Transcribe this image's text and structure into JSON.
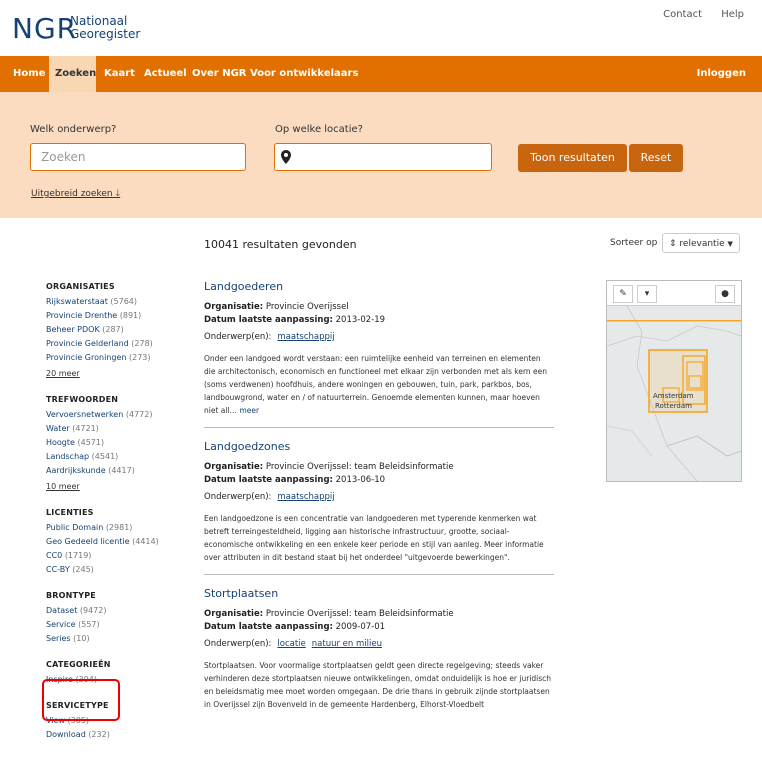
{
  "header": {
    "logo_ngr": "NGR",
    "logo_line1": "Nationaal",
    "logo_line2": "Georegister",
    "links": [
      "Contact",
      "Help"
    ]
  },
  "nav": {
    "items": [
      "Home",
      "Zoeken",
      "Kaart",
      "Actueel",
      "Over NGR",
      "Voor ontwikkelaars"
    ],
    "active": "Zoeken",
    "login": "Inloggen"
  },
  "search": {
    "topic_label": "Welk onderwerp?",
    "topic_placeholder": "Zoeken",
    "location_label": "Op welke locatie?",
    "location_placeholder": "",
    "submit_label": "Toon resultaten",
    "reset_label": "Reset",
    "advanced_label": "Uitgebreid zoeken"
  },
  "results_count": "10041 resultaten gevonden",
  "sort": {
    "label": "Sorteer op",
    "selected": "relevantie"
  },
  "facets": [
    {
      "title": "ORGANISATIES",
      "items": [
        {
          "label": "Rijkswaterstaat",
          "count": "(5764)"
        },
        {
          "label": "Provincie Drenthe",
          "count": "(891)"
        },
        {
          "label": "Beheer PDOK",
          "count": "(287)"
        },
        {
          "label": "Provincie Gelderland",
          "count": "(278)"
        },
        {
          "label": "Provincie Groningen",
          "count": "(273)"
        }
      ],
      "more": "20 meer"
    },
    {
      "title": "TREFWOORDEN",
      "items": [
        {
          "label": "Vervoersnetwerken",
          "count": "(4772)"
        },
        {
          "label": "Water",
          "count": "(4721)"
        },
        {
          "label": "Hoogte",
          "count": "(4571)"
        },
        {
          "label": "Landschap",
          "count": "(4541)"
        },
        {
          "label": "Aardrijkskunde",
          "count": "(4417)"
        }
      ],
      "more": "10 meer"
    },
    {
      "title": "LICENTIES",
      "items": [
        {
          "label": "Public Domain",
          "count": "(2981)"
        },
        {
          "label": "Geo Gedeeld licentie",
          "count": "(4414)"
        },
        {
          "label": "CC0",
          "count": "(1719)"
        },
        {
          "label": "CC-BY",
          "count": "(245)"
        }
      ],
      "more": ""
    },
    {
      "title": "BRONTYPE",
      "items": [
        {
          "label": "Dataset",
          "count": "(9472)"
        },
        {
          "label": "Service",
          "count": "(557)"
        },
        {
          "label": "Series",
          "count": "(10)"
        }
      ],
      "more": ""
    },
    {
      "title": "CATEGORIEËN",
      "items": [
        {
          "label": "Inspire",
          "count": "(394)"
        }
      ],
      "more": ""
    },
    {
      "title": "SERVICETYPE",
      "items": [
        {
          "label": "View",
          "count": "(305)"
        },
        {
          "label": "Download",
          "count": "(232)"
        }
      ],
      "more": ""
    }
  ],
  "labels": {
    "org": "Organisatie:",
    "date": "Datum laatste aanpassing:",
    "subject": "Onderwerp(en):"
  },
  "results": [
    {
      "title": "Landgoederen",
      "organisation": "Provincie Overijssel",
      "date": "2013-02-19",
      "subjects": [
        "maatschappij"
      ],
      "description": "Onder een landgoed wordt verstaan: een ruimtelijke eenheid van terreinen en elementen die architectonisch, economisch en functioneel met elkaar zijn verbonden met als kern een (soms verdwenen) hoofdhuis, andere woningen en gebouwen, tuin, park, parkbos, bos, landbouwgrond, water en / of natuurterrein. Genoemde elementen kunnen, maar hoeven niet all…",
      "more": "meer"
    },
    {
      "title": "Landgoedzones",
      "organisation": "Provincie Overijssel: team Beleidsinformatie",
      "date": "2013-06-10",
      "subjects": [
        "maatschappij"
      ],
      "description": "Een landgoedzone is een concentratie van landgoederen met typerende kenmerken wat betreft terreingesteldheid, ligging aan historische infrastructuur, grootte, sociaal-economische ontwikkeling en een enkele keer periode en stijl van aanleg. Meer informatie over attributen in dit bestand staat bij het onderdeel \"uitgevoerde bewerkingen\".",
      "more": ""
    },
    {
      "title": "Stortplaatsen",
      "organisation": "Provincie Overijssel: team Beleidsinformatie",
      "date": "2009-07-01",
      "subjects": [
        "locatie",
        "natuur en milieu"
      ],
      "description": "Stortplaatsen. Voor voormalige stortplaatsen geldt geen directe regelgeving; steeds vaker verhinderen deze stortplaatsen nieuwe ontwikkelingen, omdat onduidelijk is hoe er juridisch en beleidsmatig mee moet worden omgegaan. De drie thans in gebruik zijnde stortplaatsen in Overijssel zijn Bovenveld in de gemeente Hardenberg, Elhorst-Vloedbelt",
      "more": ""
    }
  ],
  "map": {
    "city1": "Amsterdam",
    "city2": "Rotterdam",
    "accent": "#f5a623"
  },
  "colors": {
    "brand_orange": "#e17000",
    "search_bg": "#fbdcc0",
    "link_blue": "#154273"
  }
}
